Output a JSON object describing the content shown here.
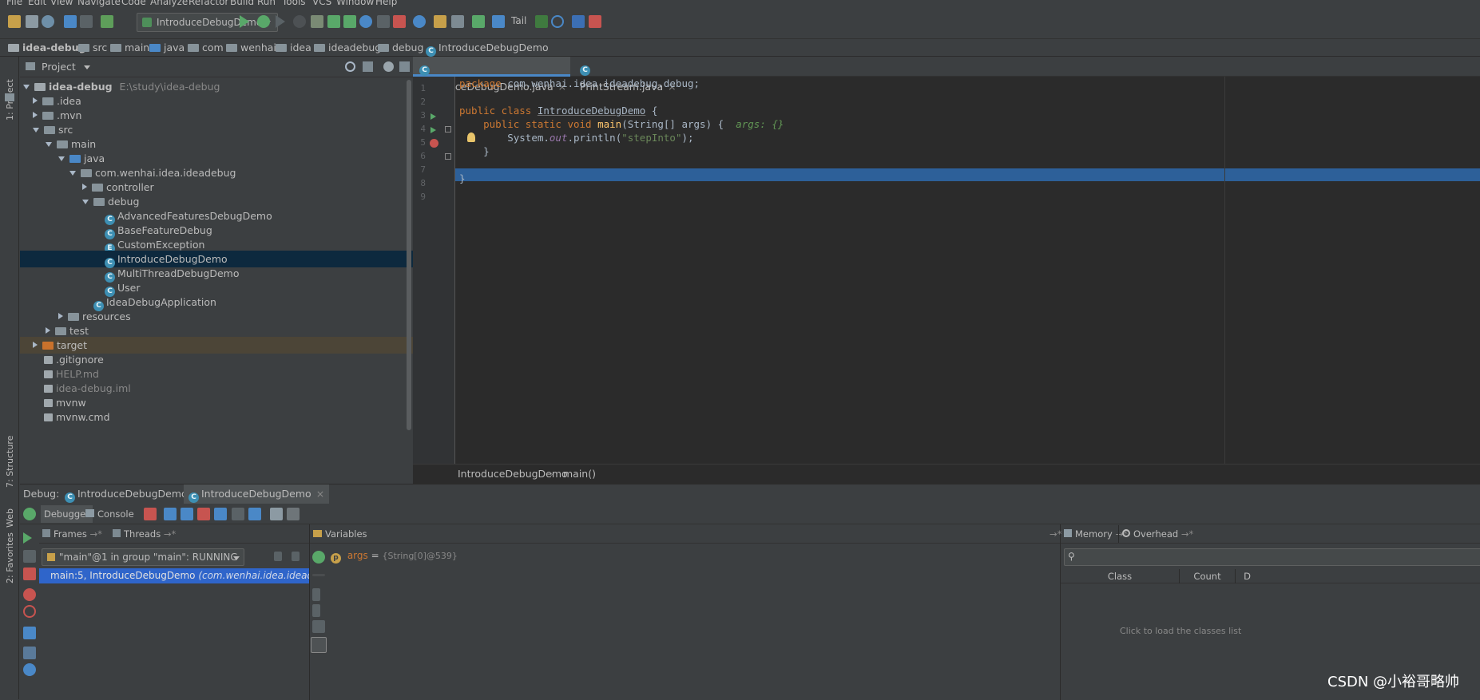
{
  "menu": [
    "File",
    "Edit",
    "View",
    "Navigate",
    "Code",
    "Analyze",
    "Refactor",
    "Build",
    "Run",
    "Tools",
    "VCS",
    "Window",
    "Help"
  ],
  "toolbar": {
    "run_config": "IntroduceDebugDemo",
    "tail_label": "Tail"
  },
  "breadcrumbs": [
    "idea-debug",
    "src",
    "main",
    "java",
    "com",
    "wenhai",
    "idea",
    "ideadebug",
    "debug",
    "IntroduceDebugDemo"
  ],
  "left_strip": {
    "project": "1: Project",
    "structure": "7: Structure",
    "web": "Web",
    "favorites": "2: Favorites"
  },
  "project": {
    "header": "Project",
    "root_name": "idea-debug",
    "root_path": "E:\\study\\idea-debug",
    "items": [
      ".idea",
      ".mvn",
      "src",
      "main",
      "java",
      "com.wenhai.idea.ideadebug",
      "controller",
      "debug",
      "AdvancedFeaturesDebugDemo",
      "BaseFeatureDebug",
      "CustomException",
      "IntroduceDebugDemo",
      "MultiThreadDebugDemo",
      "User",
      "IdeaDebugApplication",
      "resources",
      "test",
      "target",
      ".gitignore",
      "HELP.md",
      "idea-debug.iml",
      "mvnw",
      "mvnw.cmd"
    ]
  },
  "editor": {
    "tabs": [
      "IntroduceDebugDemo.java",
      "PrintStream.java"
    ],
    "line_numbers": [
      "1",
      "2",
      "3",
      "4",
      "5",
      "6",
      "7",
      "8",
      "9"
    ],
    "code": {
      "l1_kw": "package",
      "l1_rest": " com.wenhai.idea.ideadebug.debug;",
      "l3_kw": "public class",
      "l3_name": "IntroduceDebugDemo",
      "l3_brace": " {",
      "l4_kw": "public static void",
      "l4_fn": "main",
      "l4_args": "(String[] args) {",
      "l4_hint": "args: {}",
      "l5_sys": "System.",
      "l5_out": "out",
      "l5_call": ".println(",
      "l5_str": "\"stepInto\"",
      "l5_end": ");",
      "l6": "}",
      "l8": "}"
    },
    "footer": [
      "IntroduceDebugDemo",
      "main()"
    ]
  },
  "debug": {
    "label": "Debug:",
    "sessions": [
      "IntroduceDebugDemo",
      "IntroduceDebugDemo"
    ],
    "debugger_tab": "Debugger",
    "console_tab": "Console",
    "frames_tab": "Frames",
    "threads_tab": "Threads",
    "variables_tab": "Variables",
    "memory_tab": "Memory",
    "overhead_tab": "Overhead",
    "thread_selector": "\"main\"@1 in group \"main\": RUNNING",
    "frame_main": "main:5, IntroduceDebugDemo",
    "frame_pkg": "(com.wenhai.idea.ideadebug.d",
    "var_badge": "p",
    "var_name": "args",
    "var_eq": " = ",
    "var_value": "{String[0]@539}",
    "memory_col_class": "Class",
    "memory_col_count": "Count",
    "memory_col_d": "D",
    "memory_empty": "Click to load the classes list"
  },
  "watermark": "CSDN @小裕哥略帅"
}
